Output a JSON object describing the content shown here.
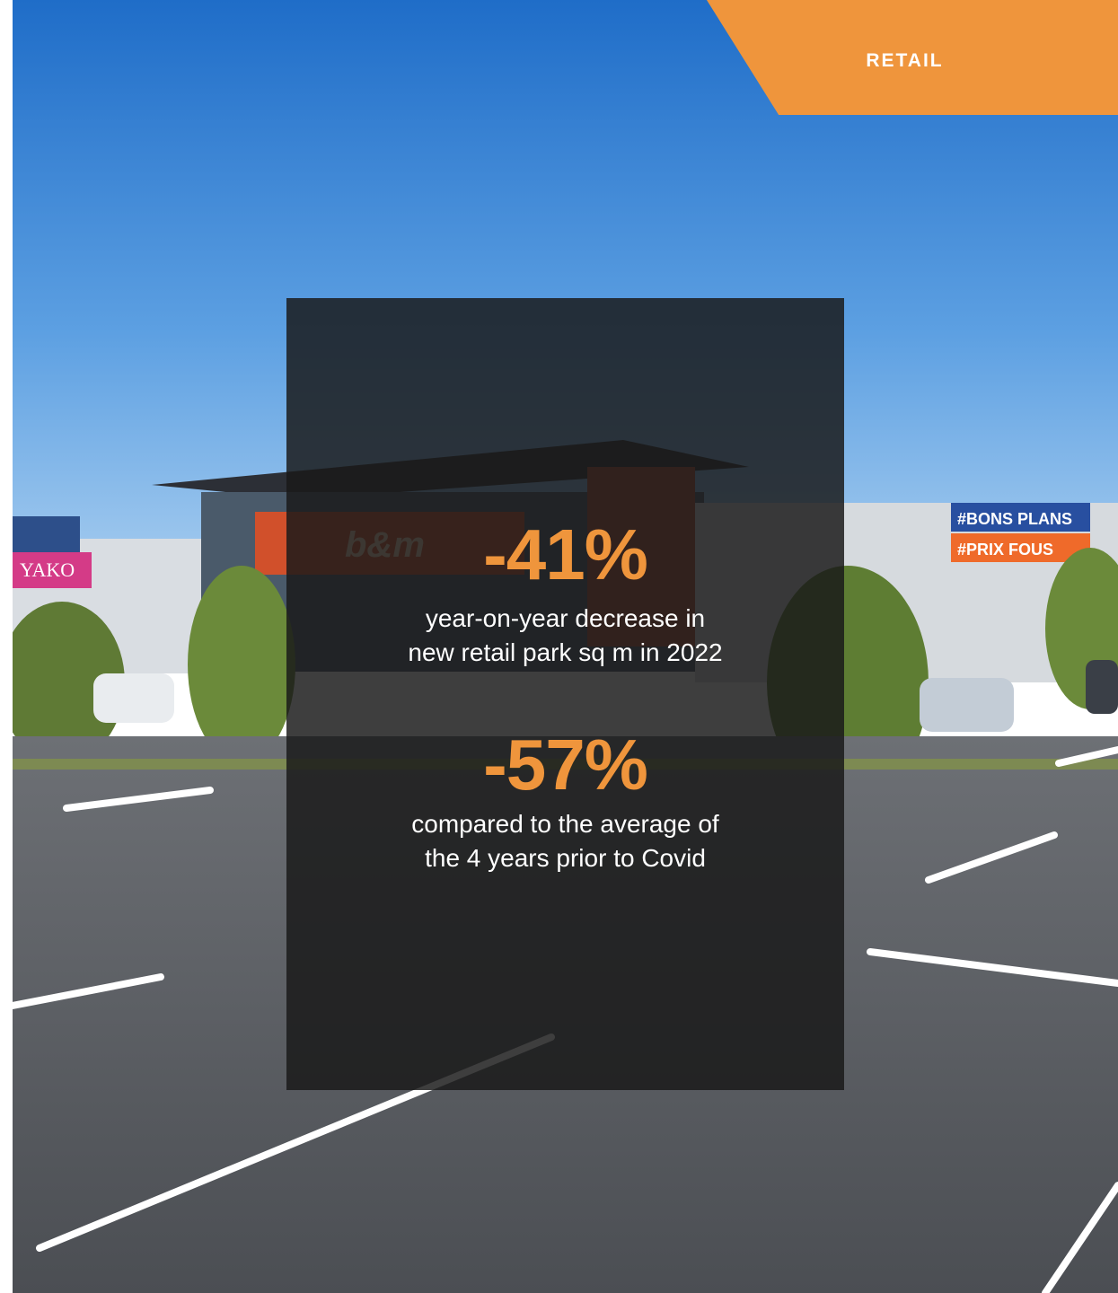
{
  "category_tag": {
    "label": "RETAIL",
    "color": "#ef953c"
  },
  "background": {
    "description_icon": "retail-park-parking-lot-photo",
    "storefront_signs": [
      "YAKO",
      "b&m",
      "#BONS PLANS",
      "#PRIX FOUS"
    ]
  },
  "stats": [
    {
      "value": "-41%",
      "description_line1": "year-on-year decrease in",
      "description_line2": "new retail park sq m in 2022"
    },
    {
      "value": "-57%",
      "description_line1": "compared to the average of",
      "description_line2": "the 4 years prior to Covid"
    }
  ],
  "colors": {
    "accent": "#ef953c",
    "overlay": "#191919"
  }
}
